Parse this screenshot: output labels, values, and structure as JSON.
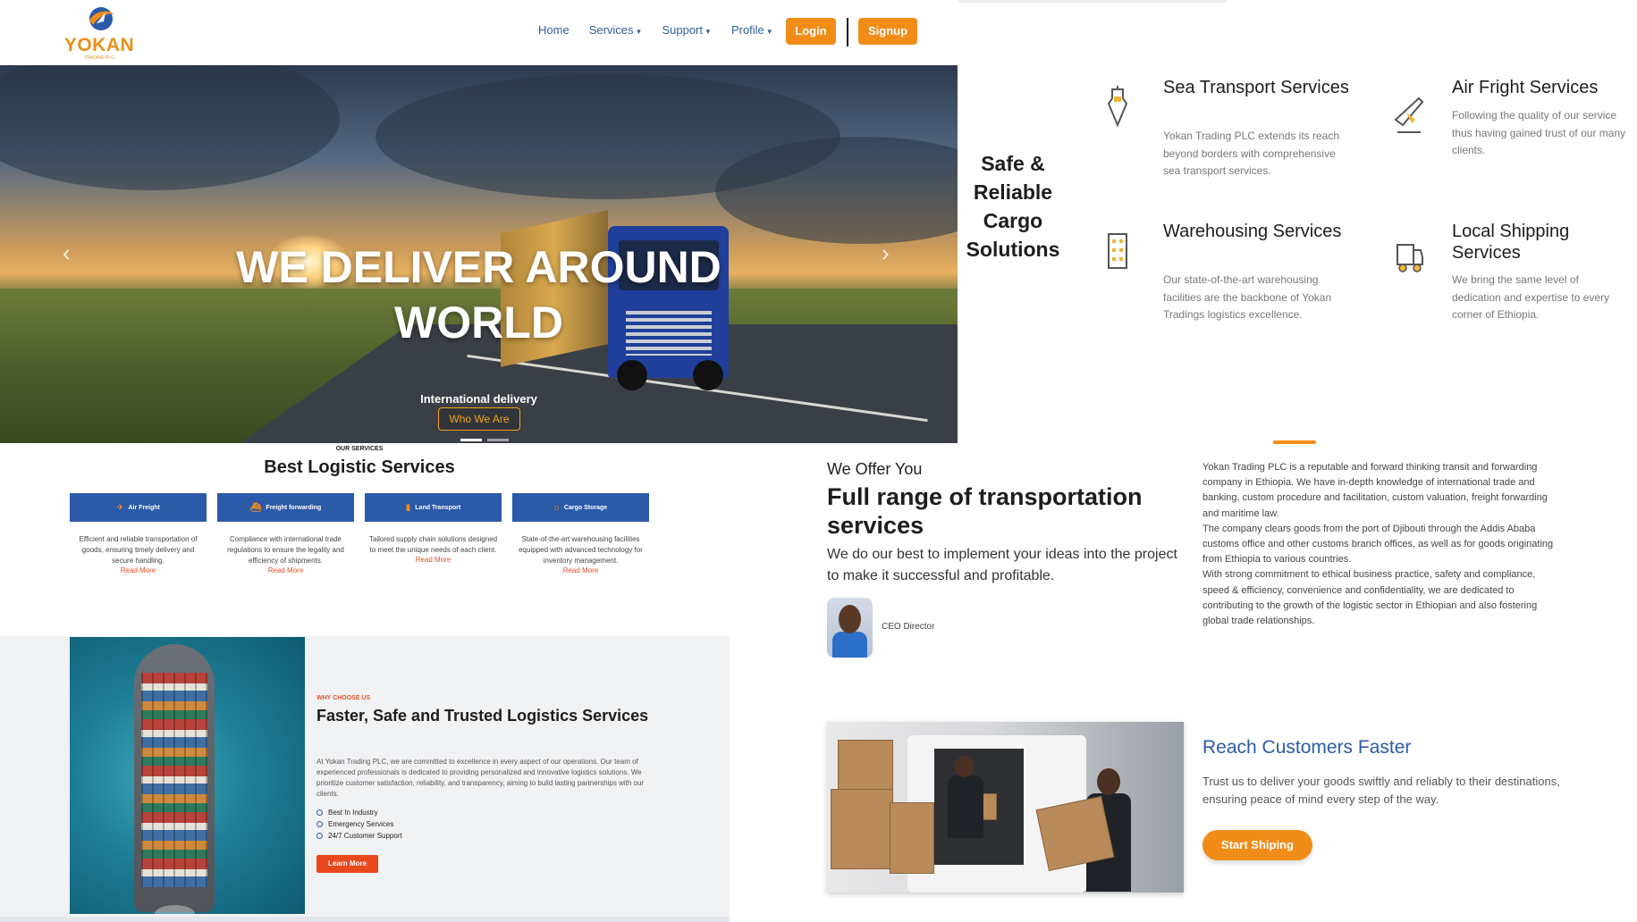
{
  "brand": {
    "name": "YOKAN",
    "tagline": "TRADING PLC"
  },
  "nav": {
    "items": [
      "Home",
      "Services",
      "Support",
      "Profile"
    ],
    "dropdown_items": [
      "Services",
      "Support",
      "Profile"
    ],
    "login": "Login",
    "signup": "Signup"
  },
  "hero": {
    "title": "WE DELIVER AROUND WORLD",
    "subtitle": "International delivery",
    "button": "Who We Are",
    "prev_icon": "chevron-left-icon",
    "next_icon": "chevron-right-icon"
  },
  "services": {
    "eyebrow": "OUR SERVICES",
    "title": "Best Logistic Services",
    "cards": [
      {
        "label": "Air Freight",
        "icon": "plane-icon",
        "desc": "Efficient and reliable transportation of goods, ensuring timely delivery and secure handling.",
        "more": "Read More"
      },
      {
        "label": "Freight forwarding",
        "icon": "ship-icon",
        "desc": "Compliance with international trade regulations to ensure the legality and efficiency of shipments.",
        "more": "Read More"
      },
      {
        "label": "Land Transport",
        "icon": "truck-icon",
        "desc": "Tailored supply chain solutions designed to meet the unique needs of each client.",
        "more": "Read More"
      },
      {
        "label": "Cargo Storage",
        "icon": "warehouse-icon",
        "desc": "State-of-the-art warehousing facilities equipped with advanced technology for inventory management.",
        "more": "Read More"
      }
    ]
  },
  "why": {
    "eyebrow": "WHY CHOOSE US",
    "title": "Faster, Safe and Trusted Logistics Services",
    "body": "At Yokan Trading PLC, we are committed to excellence in every aspect of our operations. Our team of experienced professionals is dedicated to providing personalized and innovative logistics solutions. We prioritize customer satisfaction, reliability, and transparency, aiming to build lasting partnerships with our clients.",
    "points": [
      "Best In Industry",
      "Emergency Services",
      "24/7 Customer Support"
    ],
    "button": "Learn More"
  },
  "safe": {
    "title": "Safe & Reliable Cargo Solutions",
    "features": [
      {
        "title": "Sea Transport Services",
        "icon": "anchor-icon",
        "desc": "Yokan Trading PLC extends its reach beyond borders with comprehensive sea transport services."
      },
      {
        "title": "Air Fright Services",
        "icon": "airplane-icon",
        "desc": "Following the quality of our service thus having gained trust of our many clients."
      },
      {
        "title": "Warehousing Services",
        "icon": "building-icon",
        "desc": "Our state-of-the-art warehousing facilities are the backbone of Yokan Tradings logistics excellence."
      },
      {
        "title": "Local Shipping Services",
        "icon": "delivery-truck-icon",
        "desc": "We bring the same level of dedication and expertise to every corner of Ethiopia."
      }
    ]
  },
  "offer": {
    "eyebrow": "We Offer You",
    "title": "Full range of transportation services",
    "body": "We do our best to implement your ideas into the project to make it successful and profitable.",
    "ceo_label": "CEO Director",
    "about": [
      "Yokan Trading PLC is a reputable and forward thinking transit and forwarding company in Ethiopia. We have in-depth knowledge of international trade and banking, custom procedure and facilitation, custom valuation, freight forwarding and maritime law.",
      "The company clears goods from the port of Djibouti through the Addis Ababa customs office and other customs branch offices, as well as for goods originating from Ethiopia to various countries.",
      "With strong commitment to ethical business practice, safety and compliance, speed & efficiency, convenience and confidentiality, we are dedicated to contributing to the growth of the logistic sector in Ethiopian and also fostering global trade relationships."
    ]
  },
  "reach": {
    "title": "Reach Customers Faster",
    "body": "Trust us to deliver your goods swiftly and reliably to their destinations, ensuring peace of mind every step of the way.",
    "button": "Start Shiping"
  },
  "colors": {
    "accent": "#f28c18",
    "primary": "#2b5aa8",
    "danger": "#e8481c"
  }
}
